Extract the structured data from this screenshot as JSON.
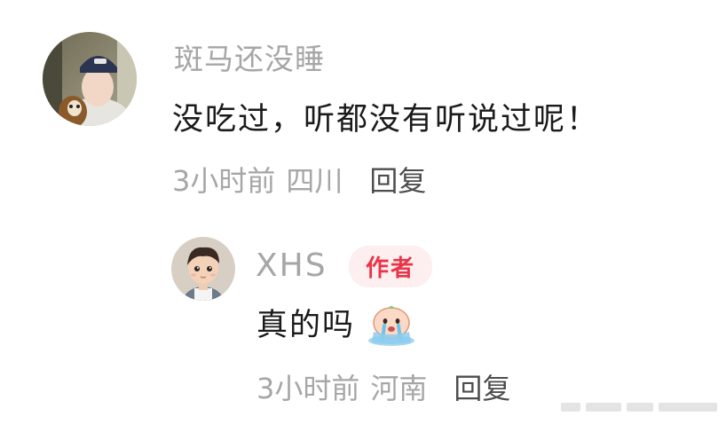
{
  "comments": [
    {
      "username": "斑马还没睡",
      "content": "没吃过，听都没有听说过呢！",
      "time": "3小时前",
      "location": "四川",
      "reply_label": "回复"
    },
    {
      "username": "XHS",
      "badge": "作者",
      "content": "真的吗",
      "emoji_icon": "crying-face-emoji-icon",
      "time": "3小时前",
      "location": "河南",
      "reply_label": "回复"
    }
  ],
  "colors": {
    "muted_text": "#a6a6a6",
    "body_text": "#1a1a1a",
    "reply_text": "#4d4d4d",
    "badge_bg": "#fdeef0",
    "badge_text": "#ea3447"
  }
}
